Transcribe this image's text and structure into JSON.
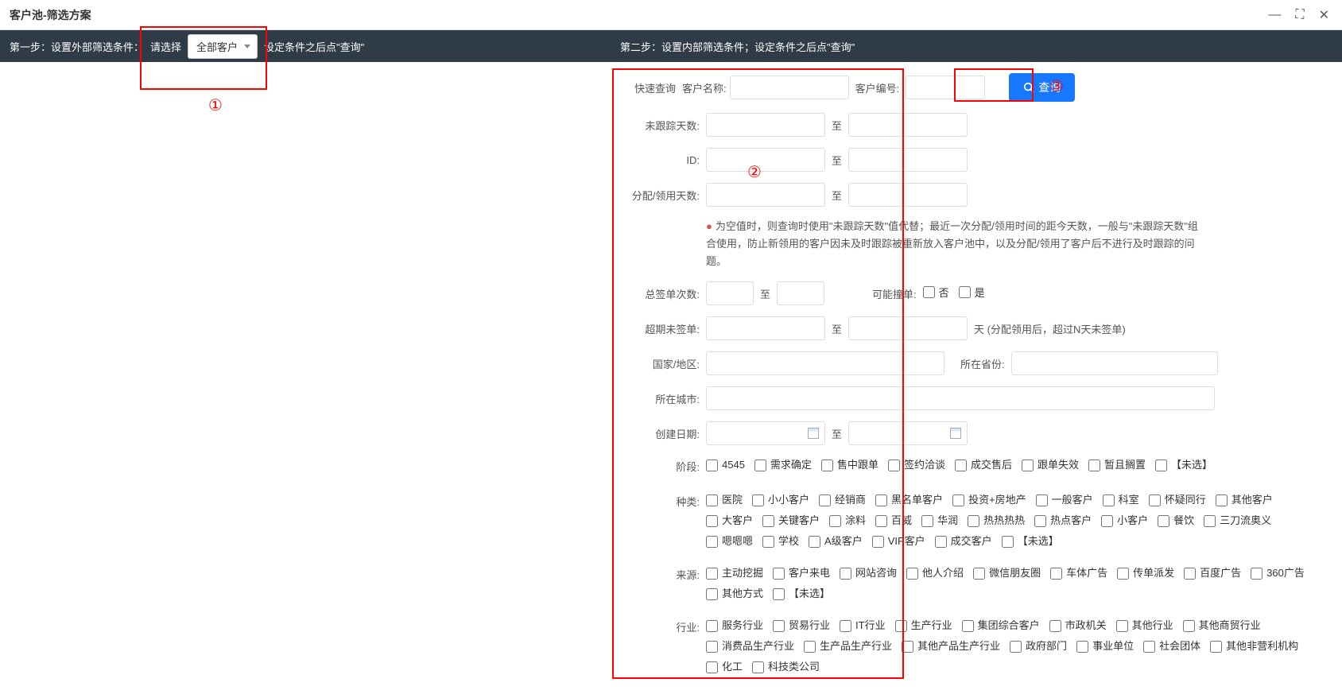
{
  "window": {
    "title": "客户池-筛选方案"
  },
  "step1": {
    "label": "第一步：设置外部筛选条件：",
    "select_label": "请选择",
    "select_value": "全部客户",
    "hint": "设定条件之后点\"查询\""
  },
  "step2": {
    "label": "第二步：设置内部筛选条件；设定条件之后点\"查询\""
  },
  "search": {
    "quick_label": "快速查询",
    "name_label": "客户名称:",
    "code_label": "客户编号:",
    "button": "查询"
  },
  "fields": {
    "untracked_days": "未跟踪天数:",
    "id": "ID:",
    "assign_days": "分配/领用天数:",
    "to": "至",
    "info": "为空值时，则查询时使用\"未跟踪天数\"值代替；最近一次分配/领用时间的距今天数，一般与\"未跟踪天数\"组合使用，防止新领用的客户因未及时跟踪被重新放入客户池中，以及分配/领用了客户后不进行及时跟踪的问题。",
    "total_sign": "总签单次数:",
    "possible_crash": "可能撞单:",
    "yes": "是",
    "no": "否",
    "overdue_unsigned": "超期未签单:",
    "days_suffix": "天 (分配领用后，超过N天未签单)",
    "country": "国家/地区:",
    "province": "所在省份:",
    "city": "所在城市:",
    "create_date": "创建日期:",
    "stage": "阶段:",
    "category": "种类:",
    "source": "来源:",
    "industry": "行业:"
  },
  "stages": [
    "4545",
    "需求确定",
    "售中跟单",
    "签约洽谈",
    "成交售后",
    "跟单失效",
    "暂且搁置",
    "【未选】"
  ],
  "categories": [
    "医院",
    "小小客户",
    "经销商",
    "黑名单客户",
    "投资+房地产",
    "一般客户",
    "科室",
    "怀疑同行",
    "其他客户",
    "大客户",
    "关键客户",
    "涂料",
    "百威",
    "华润",
    "热热热热",
    "热点客户",
    "小客户",
    "餐饮",
    "三刀流奥义",
    "嗯嗯嗯",
    "学校",
    "A级客户",
    "VIP客户",
    "成交客户",
    "【未选】"
  ],
  "sources": [
    "主动挖掘",
    "客户来电",
    "网站咨询",
    "他人介绍",
    "微信朋友圈",
    "车体广告",
    "传单派发",
    "百度广告",
    "360广告",
    "其他方式",
    "【未选】"
  ],
  "industries": [
    "服务行业",
    "贸易行业",
    "IT行业",
    "生产行业",
    "集团综合客户",
    "市政机关",
    "其他行业",
    "其他商贸行业",
    "消费品生产行业",
    "生产品生产行业",
    "其他产品生产行业",
    "政府部门",
    "事业单位",
    "社会团体",
    "其他非营利机构",
    "化工",
    "科技类公司"
  ],
  "annotations": {
    "c1": "①",
    "c2": "②",
    "c3": "③"
  }
}
